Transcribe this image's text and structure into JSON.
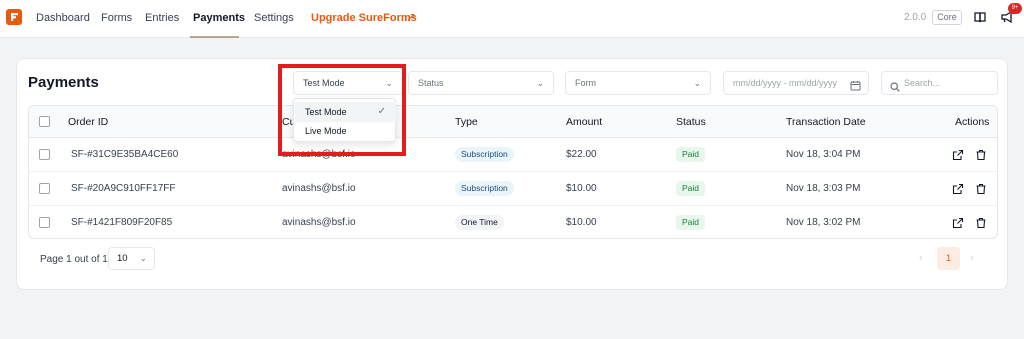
{
  "nav": {
    "items": [
      "Dashboard",
      "Forms",
      "Entries",
      "Payments",
      "Settings"
    ],
    "active": "Payments",
    "upgrade_label": "Upgrade SureForms",
    "upgrade_icon": "external-arrow-icon",
    "version": "2.0.0",
    "plan_badge": "Core",
    "notification_count": "9+"
  },
  "page": {
    "title": "Payments"
  },
  "filters": {
    "mode": "Test Mode",
    "status_placeholder": "Status",
    "form_placeholder": "Form",
    "date_placeholder": "mm/dd/yyyy - mm/dd/yyyy",
    "search_placeholder": "Search..."
  },
  "mode_dropdown": {
    "options": [
      "Test Mode",
      "Live Mode"
    ],
    "selected": "Test Mode"
  },
  "table": {
    "columns": [
      "Order ID",
      "Cu",
      "Type",
      "Amount",
      "Status",
      "Transaction Date",
      "Actions"
    ],
    "rows": [
      {
        "order_id": "SF-#31C9E35BA4CE60",
        "customer": "avinashs@bsf.io",
        "type": "Subscription",
        "amount": "$22.00",
        "status": "Paid",
        "date": "Nov 18, 3:04 PM"
      },
      {
        "order_id": "SF-#20A9C910FF17FF",
        "customer": "avinashs@bsf.io",
        "type": "Subscription",
        "amount": "$10.00",
        "status": "Paid",
        "date": "Nov 18, 3:03 PM"
      },
      {
        "order_id": "SF-#1421F809F20F85",
        "customer": "avinashs@bsf.io",
        "type": "One Time",
        "amount": "$10.00",
        "status": "Paid",
        "date": "Nov 18, 3:02 PM"
      }
    ]
  },
  "pagination": {
    "label": "Page 1 out of 1",
    "per_page": "10",
    "current_page": "1"
  },
  "colors": {
    "accent": "#e8590c",
    "highlight_box": "#e11d1d",
    "paid_green": "#15803d"
  }
}
